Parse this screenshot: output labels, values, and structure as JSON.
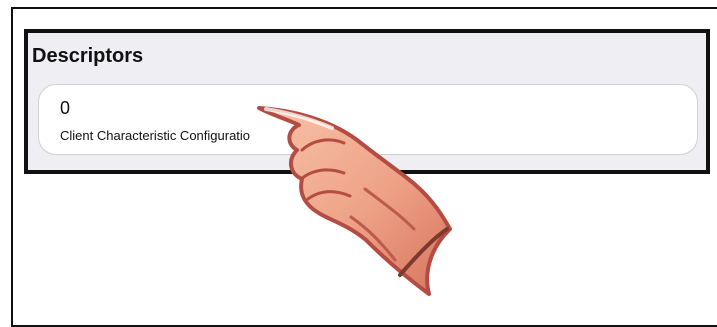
{
  "descriptors": {
    "title": "Descriptors",
    "items": [
      {
        "value": "0",
        "name": "Client Characteristic Configuratio"
      }
    ]
  },
  "overlay": {
    "icon": "pointing-hand-icon"
  }
}
